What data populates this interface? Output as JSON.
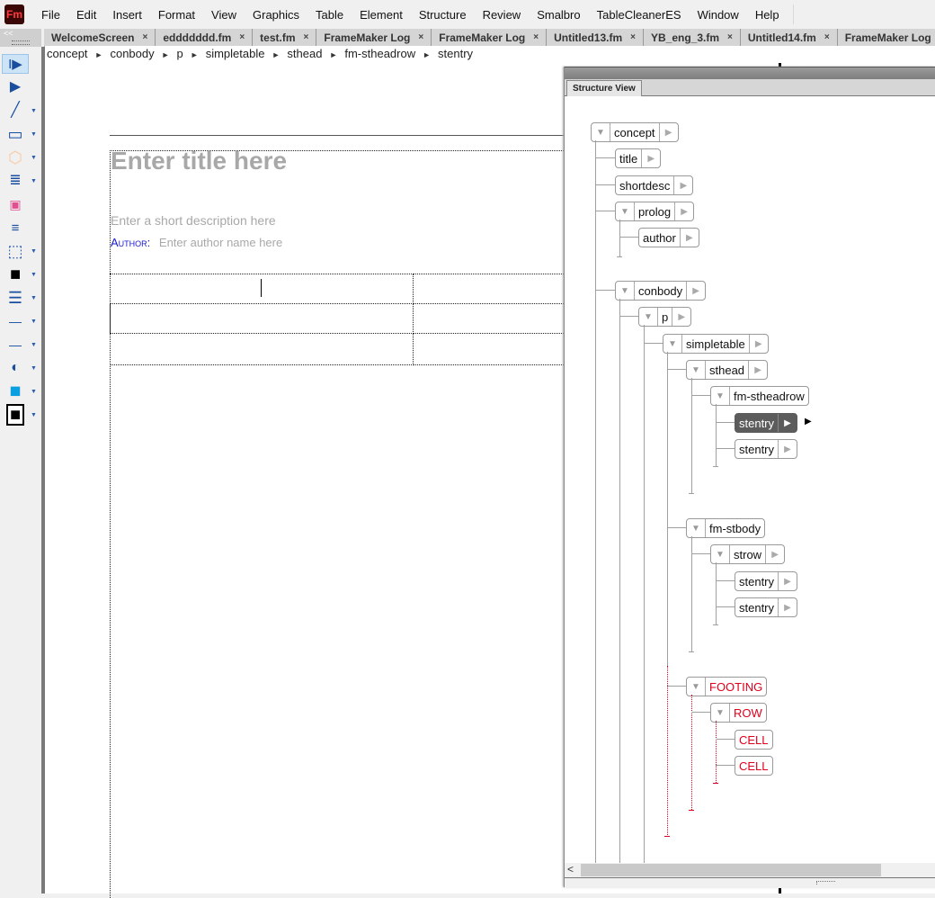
{
  "app": {
    "logo": "Fm"
  },
  "menu": [
    "File",
    "Edit",
    "Insert",
    "Format",
    "View",
    "Graphics",
    "Table",
    "Element",
    "Structure",
    "Review",
    "Smalbro",
    "TableCleanerES",
    "Window",
    "Help"
  ],
  "tabs": [
    {
      "label": "WelcomeScreen"
    },
    {
      "label": "eddddddd.fm"
    },
    {
      "label": "test.fm"
    },
    {
      "label": "FrameMaker Log"
    },
    {
      "label": "FrameMaker Log"
    },
    {
      "label": "Untitled13.fm"
    },
    {
      "label": "YB_eng_3.fm"
    },
    {
      "label": "Untitled14.fm"
    },
    {
      "label": "FrameMaker Log"
    }
  ],
  "tab_close_glyph": "×",
  "breadcrumb": [
    "concept",
    "conbody",
    "p",
    "simpletable",
    "sthead",
    "fm-stheadrow",
    "stentry"
  ],
  "breadcrumb_sep": "►",
  "toolbox": {
    "collapse_glyph": "<<",
    "tools": [
      {
        "name": "smart-select-tool",
        "glyph": "I▶"
      },
      {
        "name": "object-select-tool",
        "glyph": "▶"
      },
      {
        "name": "line-tool",
        "glyph": "╱"
      },
      {
        "name": "rectangle-tool",
        "glyph": "▭"
      },
      {
        "name": "polygon-tool",
        "glyph": "⬡"
      },
      {
        "name": "text-frame-tool",
        "glyph": "≣"
      },
      {
        "name": "image-tool",
        "glyph": "▣"
      },
      {
        "name": "format-painter-tool",
        "glyph": "≡"
      },
      {
        "name": "selection-rect-tool",
        "glyph": "⬚"
      },
      {
        "name": "fill-tool",
        "glyph": "■"
      },
      {
        "name": "line-width-tool",
        "glyph": "☰"
      },
      {
        "name": "line-end-tool",
        "glyph": "—"
      },
      {
        "name": "dash-tool",
        "glyph": "—"
      },
      {
        "name": "tint-tool",
        "glyph": "◐"
      },
      {
        "name": "overprint-tool",
        "glyph": "◼"
      },
      {
        "name": "color-tool",
        "glyph": "■"
      }
    ]
  },
  "document": {
    "title_placeholder": "Enter title here",
    "shortdesc_placeholder": "Enter a short description here",
    "author_label": "Author:",
    "author_placeholder": "Enter author name here"
  },
  "structure_view": {
    "tab_label": "Structure View",
    "expand_glyph": "▼",
    "arrow_glyph": "▶",
    "scroll_left_glyph": "<",
    "nodes": [
      {
        "label": "concept",
        "expanded": true
      },
      {
        "label": "title"
      },
      {
        "label": "shortdesc"
      },
      {
        "label": "prolog",
        "expanded": true
      },
      {
        "label": "author"
      },
      {
        "label": "conbody",
        "expanded": true
      },
      {
        "label": "p",
        "expanded": true
      },
      {
        "label": "simpletable",
        "expanded": true
      },
      {
        "label": "sthead",
        "expanded": true
      },
      {
        "label": "fm-stheadrow",
        "expanded": true
      },
      {
        "label": "stentry",
        "selected": true
      },
      {
        "label": "stentry"
      },
      {
        "label": "fm-stbody",
        "expanded": true
      },
      {
        "label": "strow",
        "expanded": true
      },
      {
        "label": "stentry"
      },
      {
        "label": "stentry"
      },
      {
        "label": "FOOTING",
        "expanded": true,
        "invalid": true
      },
      {
        "label": "ROW",
        "expanded": true,
        "invalid": true
      },
      {
        "label": "CELL",
        "invalid": true
      },
      {
        "label": "CELL",
        "invalid": true
      }
    ]
  },
  "colors": {
    "invalid_element": "#e0001b",
    "selected_node": "#5c5c5c",
    "author_label": "#1a1acc",
    "placeholder": "#a8a8a8"
  }
}
